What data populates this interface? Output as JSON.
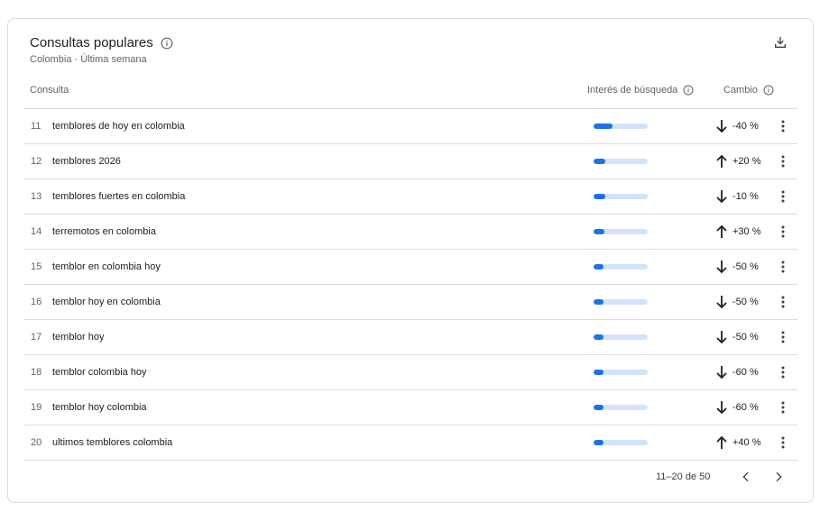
{
  "card": {
    "title": "Consultas populares",
    "subtitle": "Colombia · Última semana",
    "icons": {
      "info": "info-icon",
      "download": "download-icon"
    }
  },
  "columns": {
    "query": "Consulta",
    "interest": "Interés de búsqueda",
    "change": "Cambio"
  },
  "colors": {
    "bar_fill": "#1a73e8",
    "bar_track": "#d2e3fc"
  },
  "rows": [
    {
      "rank": "11",
      "query": "temblores de hoy en colombia",
      "interest": 0.35,
      "direction": "down",
      "change": "-40 %"
    },
    {
      "rank": "12",
      "query": "temblores 2026",
      "interest": 0.22,
      "direction": "up",
      "change": "+20 %"
    },
    {
      "rank": "13",
      "query": "temblores fuertes en colombia",
      "interest": 0.22,
      "direction": "down",
      "change": "-10 %"
    },
    {
      "rank": "14",
      "query": "terremotos en colombia",
      "interest": 0.2,
      "direction": "up",
      "change": "+30 %"
    },
    {
      "rank": "15",
      "query": "temblor en colombia hoy",
      "interest": 0.18,
      "direction": "down",
      "change": "-50 %"
    },
    {
      "rank": "16",
      "query": "temblor hoy en colombia",
      "interest": 0.18,
      "direction": "down",
      "change": "-50 %"
    },
    {
      "rank": "17",
      "query": "temblor hoy",
      "interest": 0.18,
      "direction": "down",
      "change": "-50 %"
    },
    {
      "rank": "18",
      "query": "temblor colombia hoy",
      "interest": 0.18,
      "direction": "down",
      "change": "-60 %"
    },
    {
      "rank": "19",
      "query": "temblor hoy colombia",
      "interest": 0.18,
      "direction": "down",
      "change": "-60 %"
    },
    {
      "rank": "20",
      "query": "ultimos temblores colombia",
      "interest": 0.18,
      "direction": "up",
      "change": "+40 %"
    }
  ],
  "pagination": {
    "label": "11–20 de 50"
  }
}
